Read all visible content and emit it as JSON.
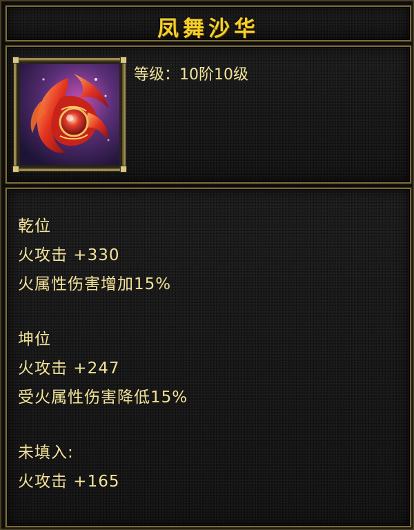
{
  "item": {
    "name": "凤舞沙华",
    "icon": "phoenix-feather-icon",
    "level_label": "等级：",
    "level_value": "10阶10级"
  },
  "sections": [
    {
      "slot": "乾位",
      "lines": [
        "火攻击 +330",
        "火属性伤害增加15%"
      ]
    },
    {
      "slot": "坤位",
      "lines": [
        "火攻击 +247",
        "受火属性伤害降低15%"
      ]
    },
    {
      "slot": "未填入:",
      "lines": [
        "火攻击 +165"
      ]
    }
  ],
  "colors": {
    "title": "#f2cf2a",
    "text": "#f3e39a",
    "frame": "#7a6a3a",
    "background": "#161616"
  }
}
